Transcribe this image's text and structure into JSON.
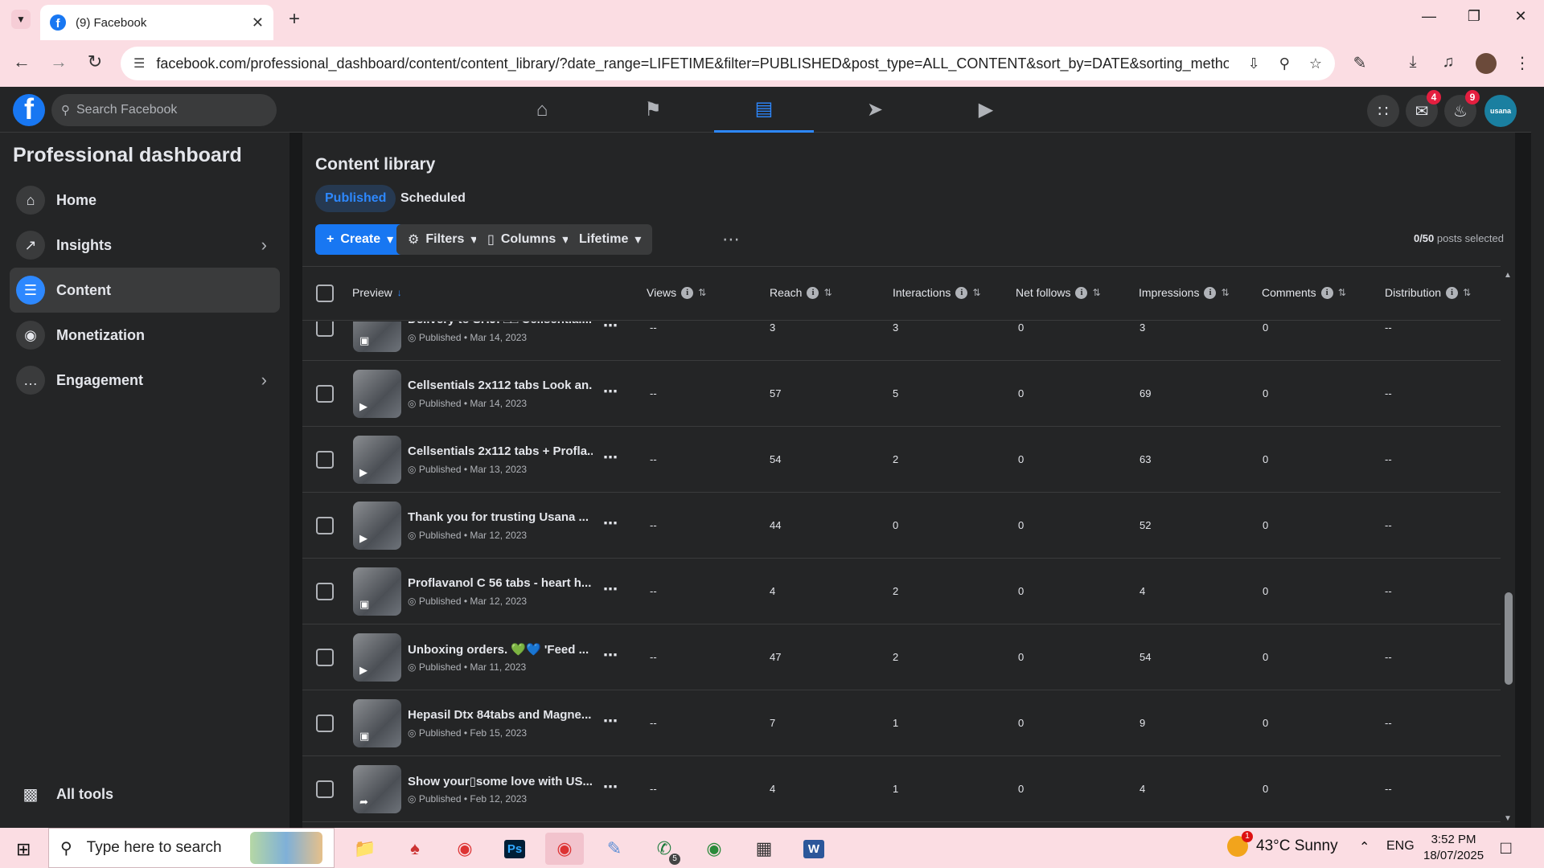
{
  "browser": {
    "tab_title": "(9) Facebook",
    "url": "facebook.com/professional_dashboard/content/content_library/?date_range=LIFETIME&filter=PUBLISHED&post_type=ALL_CONTENT&sort_by=DATE&sorting_method=..."
  },
  "header": {
    "search_placeholder": "Search Facebook",
    "messenger_badge": "4",
    "notifications_badge": "9",
    "avatar_text": "usana"
  },
  "sidebar": {
    "title": "Professional dashboard",
    "items": [
      {
        "label": "Home"
      },
      {
        "label": "Insights"
      },
      {
        "label": "Content"
      },
      {
        "label": "Monetization"
      },
      {
        "label": "Engagement"
      }
    ],
    "all_tools": "All tools"
  },
  "content": {
    "title": "Content library",
    "tabs": [
      "Published",
      "Scheduled"
    ],
    "buttons": {
      "create": "Create",
      "filters": "Filters",
      "columns": "Columns",
      "lifetime": "Lifetime"
    },
    "selected_count": "0/50",
    "selected_suffix": " posts selected",
    "columns": [
      "Preview",
      "Views",
      "Reach",
      "Interactions",
      "Net follows",
      "Impressions",
      "Comments",
      "Distribution"
    ],
    "rows": [
      {
        "title": "Delivery to SHJ! □□ Cellsential...",
        "meta": "Published • Mar 14, 2023",
        "type": "photo",
        "views": "--",
        "reach": "3",
        "interactions": "3",
        "net_follows": "0",
        "impressions": "3",
        "comments": "0",
        "distribution": "--"
      },
      {
        "title": "Cellsentials 2x112 tabs Look an...",
        "meta": "Published • Mar 14, 2023",
        "type": "video",
        "views": "--",
        "reach": "57",
        "interactions": "5",
        "net_follows": "0",
        "impressions": "69",
        "comments": "0",
        "distribution": "--"
      },
      {
        "title": "Cellsentials 2x112 tabs + Profla...",
        "meta": "Published • Mar 13, 2023",
        "type": "video",
        "views": "--",
        "reach": "54",
        "interactions": "2",
        "net_follows": "0",
        "impressions": "63",
        "comments": "0",
        "distribution": "--"
      },
      {
        "title": "Thank you for trusting Usana ...",
        "meta": "Published • Mar 12, 2023",
        "type": "video",
        "views": "--",
        "reach": "44",
        "interactions": "0",
        "net_follows": "0",
        "impressions": "52",
        "comments": "0",
        "distribution": "--"
      },
      {
        "title": "Proflavanol C 56 tabs - heart h...",
        "meta": "Published • Mar 12, 2023",
        "type": "photo",
        "views": "--",
        "reach": "4",
        "interactions": "2",
        "net_follows": "0",
        "impressions": "4",
        "comments": "0",
        "distribution": "--"
      },
      {
        "title": "Unboxing orders. 💚💙 'Feed ...",
        "meta": "Published • Mar 11, 2023",
        "type": "video",
        "views": "--",
        "reach": "47",
        "interactions": "2",
        "net_follows": "0",
        "impressions": "54",
        "comments": "0",
        "distribution": "--"
      },
      {
        "title": "Hepasil Dtx 84tabs and Magne...",
        "meta": "Published • Feb 15, 2023",
        "type": "photo",
        "views": "--",
        "reach": "7",
        "interactions": "1",
        "net_follows": "0",
        "impressions": "9",
        "comments": "0",
        "distribution": "--"
      },
      {
        "title": "Show your▯some love with US...",
        "meta": "Published • Feb 12, 2023",
        "type": "share",
        "views": "--",
        "reach": "4",
        "interactions": "1",
        "net_follows": "0",
        "impressions": "4",
        "comments": "0",
        "distribution": "--"
      }
    ]
  },
  "taskbar": {
    "search_placeholder": "Type here to search",
    "whatsapp_badge": "5",
    "weather": "43°C  Sunny",
    "weather_badge": "1",
    "language": "ENG",
    "time": "3:52 PM",
    "date": "18/07/2025"
  }
}
